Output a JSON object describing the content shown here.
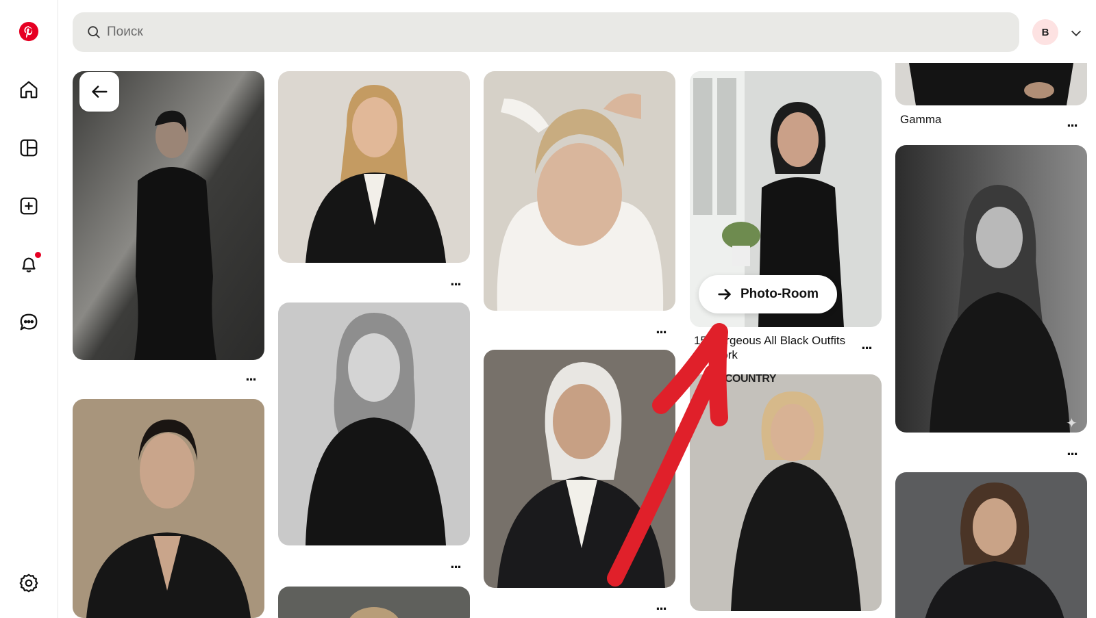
{
  "search": {
    "placeholder": "Поиск"
  },
  "account": {
    "initial": "B"
  },
  "sidebar": {
    "items": [
      {
        "icon": "pinterest-logo"
      },
      {
        "icon": "home-icon"
      },
      {
        "icon": "boards-icon"
      },
      {
        "icon": "create-icon"
      },
      {
        "icon": "notifications-icon",
        "badge": true
      },
      {
        "icon": "messages-icon"
      },
      {
        "icon": "settings-icon"
      }
    ]
  },
  "pins": {
    "gamma_title": "Gamma",
    "outfits_title_line1": "15 Gorgeous All Black Outfits",
    "outfits_title_line2": "for Work",
    "photo_room_label": "Photo-Room",
    "country_label": "COUNTRY",
    "more_label": "..."
  },
  "colors": {
    "accent": "#e60023",
    "annotation_arrow": "#e0202a",
    "search_bg": "#e9e9e6"
  }
}
